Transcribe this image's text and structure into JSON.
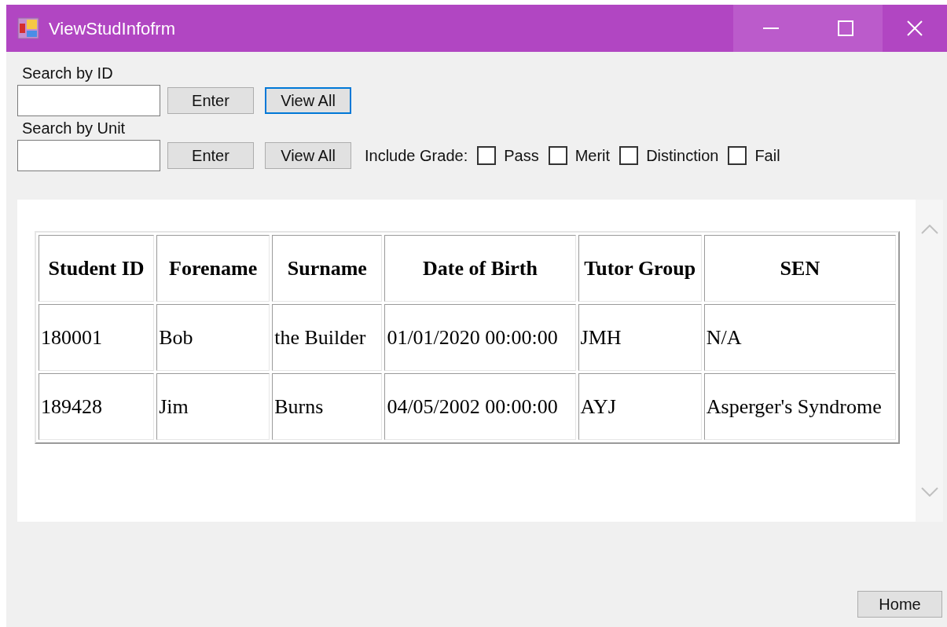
{
  "window": {
    "title": "ViewStudInfofrm"
  },
  "search_by_id": {
    "label": "Search by ID",
    "buttons": [
      {
        "label": "Enter",
        "focused": false
      },
      {
        "label": "View All",
        "focused": true
      }
    ]
  },
  "search_by_unit": {
    "label": "Search by Unit",
    "buttons": [
      {
        "label": "Enter",
        "focused": false
      },
      {
        "label": "View All",
        "focused": false
      }
    ],
    "grade_label": "Include Grade:",
    "grades": [
      {
        "label": "Pass",
        "checked": false
      },
      {
        "label": "Merit",
        "checked": false
      },
      {
        "label": "Distinction",
        "checked": false
      },
      {
        "label": "Fail",
        "checked": false
      }
    ]
  },
  "table": {
    "columns": [
      "Student ID",
      "Forename",
      "Surname",
      "Date of Birth",
      "Tutor Group",
      "SEN"
    ],
    "rows": [
      [
        "180001",
        "Bob",
        "the Builder",
        "01/01/2020 00:00:00",
        "JMH",
        "N/A"
      ],
      [
        "189428",
        "Jim",
        "Burns",
        "04/05/2002 00:00:00",
        "AYJ",
        "Asperger's Syndrome"
      ]
    ]
  },
  "home_button": "Home"
}
